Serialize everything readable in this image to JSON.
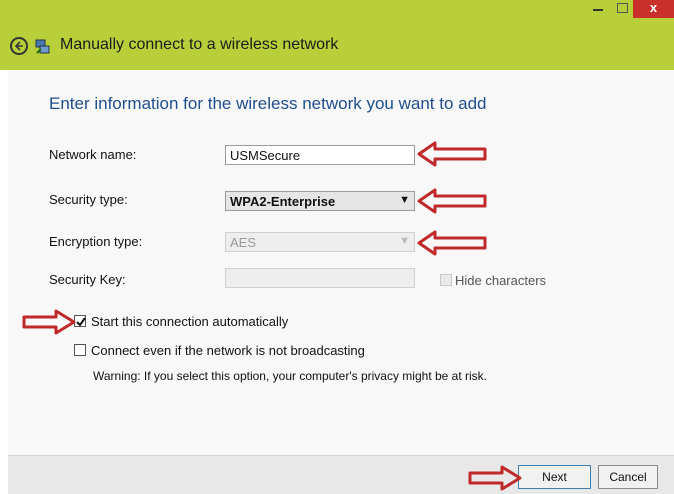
{
  "window": {
    "title": "Manually connect to a wireless network",
    "close_glyph": "x",
    "accent": "#b9cf3a"
  },
  "form": {
    "heading": "Enter information for the wireless network you want to add",
    "network_name": {
      "label": "Network name:",
      "value": "USMSecure"
    },
    "security_type": {
      "label": "Security type:",
      "value": "WPA2-Enterprise"
    },
    "encryption_type": {
      "label": "Encryption type:",
      "value": "AES"
    },
    "security_key": {
      "label": "Security Key:",
      "value": ""
    },
    "hide_characters": {
      "label": "Hide characters",
      "checked": false
    }
  },
  "options": {
    "start_automatically": {
      "label": "Start this connection automatically",
      "checked": true
    },
    "connect_not_broadcasting": {
      "label": "Connect even if the network is not broadcasting",
      "checked": false
    },
    "warning": "Warning: If you select this option, your computer's privacy might be at risk."
  },
  "buttons": {
    "next": "Next",
    "cancel": "Cancel"
  },
  "annotation_color": "#c0282a"
}
